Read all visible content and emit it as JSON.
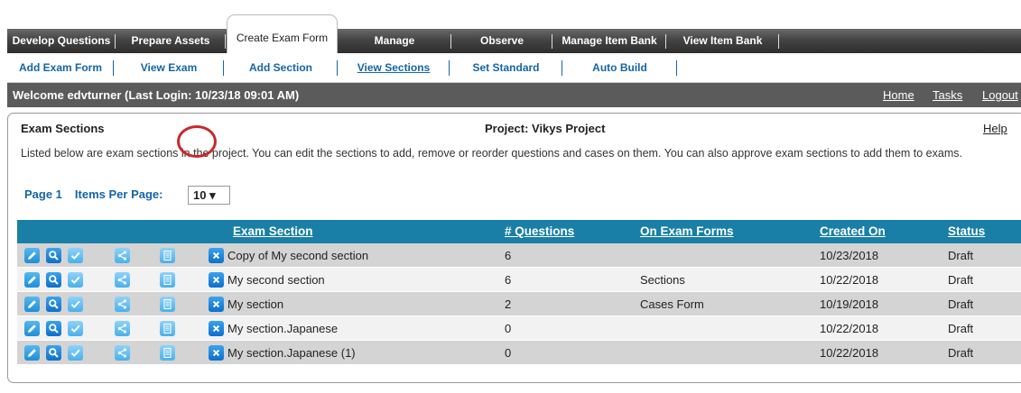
{
  "tabs": [
    {
      "label": "Develop Questions"
    },
    {
      "label": "Prepare Assets"
    },
    {
      "label": "Create Exam Form"
    },
    {
      "label": "Manage"
    },
    {
      "label": "Observe"
    },
    {
      "label": "Manage Item Bank"
    },
    {
      "label": "View Item Bank"
    }
  ],
  "subnav": [
    {
      "label": "Add Exam Form"
    },
    {
      "label": "View Exam"
    },
    {
      "label": "Add Section"
    },
    {
      "label": "View Sections"
    },
    {
      "label": "Set Standard"
    },
    {
      "label": "Auto Build"
    }
  ],
  "welcome": {
    "message": "Welcome edvturner (Last Login: 10/23/18   09:01 AM)",
    "home": "Home",
    "tasks": "Tasks",
    "logout": "Logout"
  },
  "panel": {
    "title": "Exam Sections",
    "project": "Project: Vikys Project",
    "help": "Help",
    "description": "Listed below are exam sections in the project. You can edit the sections to add, remove or reorder questions and cases on them. You can also approve exam sections to add them to exams.",
    "page": "Page 1",
    "items_per_page_label": "Items Per Page:",
    "items_per_page_value": "10 ▾"
  },
  "table": {
    "headers": {
      "section": "Exam Section",
      "questions": "# Questions",
      "forms": "On Exam Forms",
      "created": "Created On",
      "status": "Status"
    },
    "rows": [
      {
        "section": "Copy of My second section",
        "questions": "6",
        "forms": "",
        "created": "10/23/2018",
        "status": "Draft"
      },
      {
        "section": "My second section",
        "questions": "6",
        "forms": "Sections",
        "created": "10/22/2018",
        "status": "Draft"
      },
      {
        "section": "My section",
        "questions": "2",
        "forms": "Cases Form",
        "created": "10/19/2018",
        "status": "Draft"
      },
      {
        "section": "My section.Japanese",
        "questions": "0",
        "forms": "",
        "created": "10/22/2018",
        "status": "Draft"
      },
      {
        "section": "My section.Japanese (1)",
        "questions": "0",
        "forms": "",
        "created": "10/22/2018",
        "status": "Draft"
      }
    ]
  },
  "icons": [
    "edit-icon",
    "search-icon",
    "approve-icon",
    "share-icon",
    "document-icon",
    "delete-icon"
  ],
  "colors": {
    "header_blue": "#1a7fa6",
    "link_blue": "#1565a6",
    "highlight_red": "#c8282d",
    "welcome_bar": "#5b5b5b"
  }
}
